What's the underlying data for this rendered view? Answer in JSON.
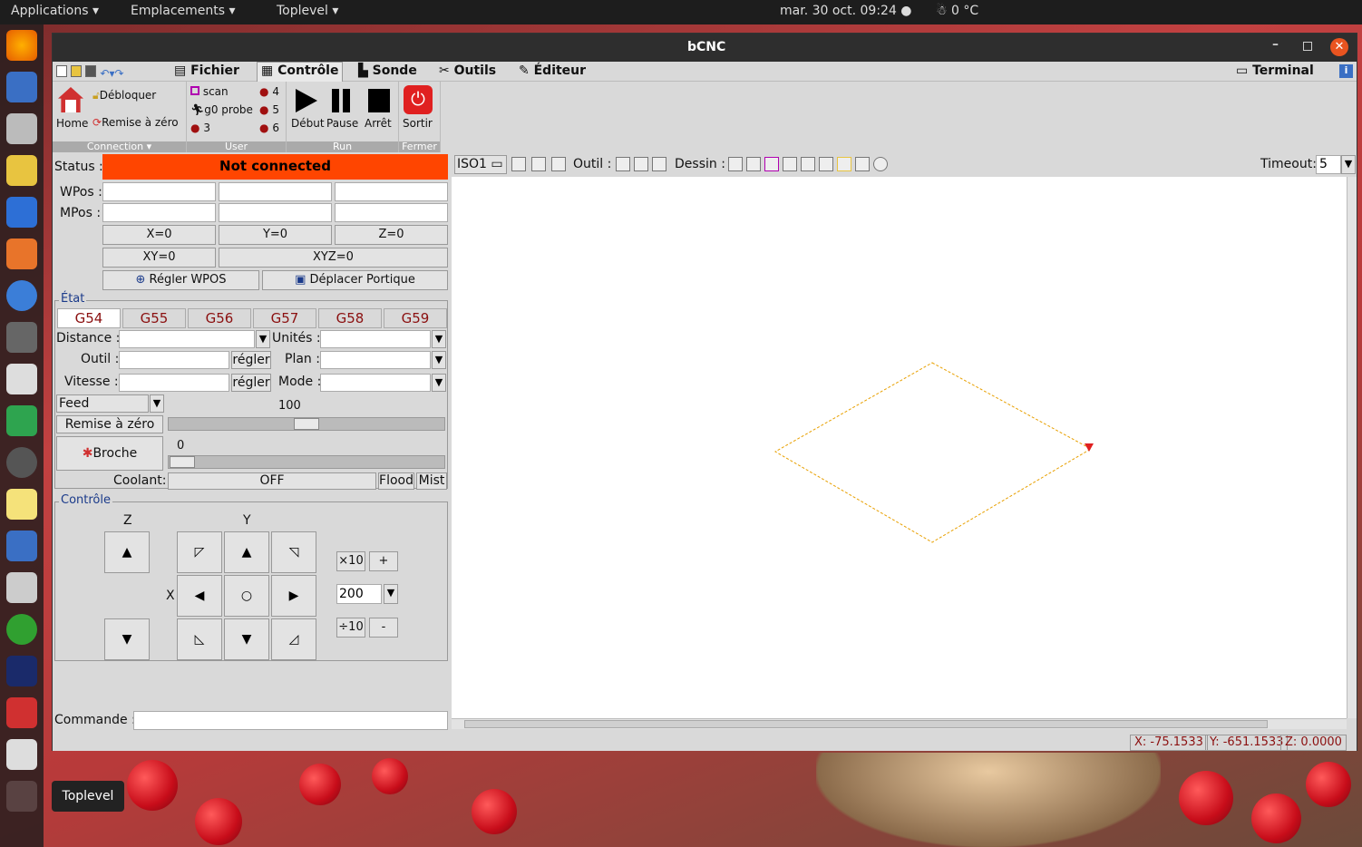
{
  "topbar": {
    "applications": "Applications",
    "places": "Emplacements",
    "toplevel": "Toplevel",
    "clock": "mar. 30 oct.  09:24",
    "weather": "0 °C"
  },
  "window": {
    "title": "bCNC"
  },
  "menu": {
    "fichier": "Fichier",
    "controle": "Contrôle",
    "sonde": "Sonde",
    "outils": "Outils",
    "editeur": "Éditeur",
    "terminal": "Terminal"
  },
  "ribbon": {
    "home": "Home",
    "debloquer": "Débloquer",
    "remise": "Remise à zéro",
    "connection": "Connection",
    "scan": "scan",
    "g0probe": "g0 probe",
    "n3": "3",
    "n4": "4",
    "n5": "5",
    "n6": "6",
    "user": "User",
    "debut": "Début",
    "pause": "Pause",
    "arret": "Arrêt",
    "run": "Run",
    "sortir": "Sortir",
    "fermer": "Fermer"
  },
  "control": {
    "status_label": "Status :",
    "status_value": "Not connected",
    "status_color": "#ff4500",
    "wpos": "WPos :",
    "mpos": "MPos :",
    "x0": "X=0",
    "y0": "Y=0",
    "z0": "Z=0",
    "xy0": "XY=0",
    "xyz0": "XYZ=0",
    "regler_wpos": "Régler WPOS",
    "deplacer": "Déplacer Portique",
    "etat": "État",
    "gcodes": [
      "G54",
      "G55",
      "G56",
      "G57",
      "G58",
      "G59"
    ],
    "distance": "Distance :",
    "unites": "Unités :",
    "outil": "Outil :",
    "plan": "Plan :",
    "vitesse": "Vitesse :",
    "mode": "Mode :",
    "regler": "régler",
    "feed": "Feed",
    "feed_value": "100",
    "remise": "Remise à zéro",
    "broche": "Broche",
    "broche_value": "0",
    "coolant": "Coolant:",
    "coolant_value": "OFF",
    "flood": "Flood",
    "mist": "Mist",
    "controle": "Contrôle",
    "z": "Z",
    "y": "Y",
    "x": "X",
    "x10": "×10",
    "plus": "+",
    "step": "200",
    "div10": "÷10",
    "minus": "-",
    "commande": "Commande :"
  },
  "canvasbar": {
    "view": "ISO1",
    "outil": "Outil :",
    "dessin": "Dessin :",
    "timeout": "Timeout:",
    "timeout_value": "5"
  },
  "status": {
    "x": "X: -75.1533",
    "y": "Y: -651.1533",
    "z": "Z: 0.0000"
  },
  "tooltip": "Toplevel"
}
